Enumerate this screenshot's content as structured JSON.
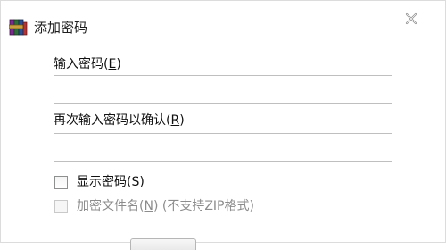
{
  "window": {
    "title": "添加密码",
    "close_icon": "close-icon",
    "app_icon": "winrar-books-icon"
  },
  "password_field": {
    "label_prefix": "输入密码(",
    "label_key": "E",
    "label_suffix": ")",
    "value": ""
  },
  "confirm_field": {
    "label_prefix": "再次输入密码以确认(",
    "label_key": "R",
    "label_suffix": ")",
    "value": ""
  },
  "show_password": {
    "label_prefix": "显示密码(",
    "label_key": "S",
    "label_suffix": ")",
    "checked": false
  },
  "encrypt_filenames": {
    "label_prefix": "加密文件名(",
    "label_key": "N",
    "label_suffix": ") (不支持ZIP格式)",
    "checked": false,
    "disabled": true
  }
}
